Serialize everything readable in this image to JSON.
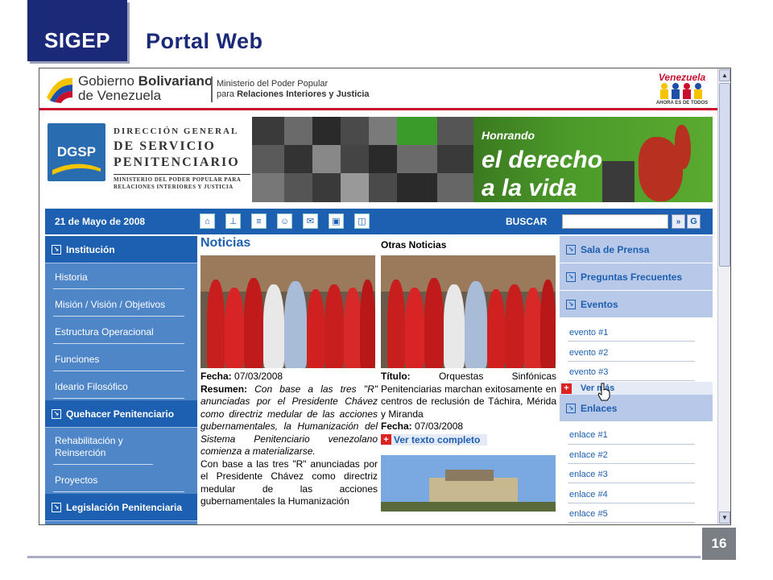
{
  "slide": {
    "brand": "SIGEP",
    "title": "Portal Web",
    "page_number": "16"
  },
  "header": {
    "gov_line1": "Gobierno ",
    "gov_line1_bold": "Bolivariano",
    "gov_line2": "de Venezuela",
    "ministry_line1": "Ministerio del Poder Popular",
    "ministry_line2_prefix": "para ",
    "ministry_line2": "Relaciones Interiores y Justicia",
    "venezuela_logo": "Venezuela",
    "venezuela_slogan": "AHORA ES DE TODOS"
  },
  "dgsp": {
    "acronym": "DGSP",
    "line1": "DIRECCIÓN GENERAL",
    "line2": "DE SERVICIO",
    "line3": "PENITENCIARIO",
    "line4": "MINISTERIO DEL PODER POPULAR PARA RELACIONES INTERIORES Y JUSTICIA"
  },
  "banner": {
    "line1": "Honrando",
    "line2": "el derecho",
    "line3": "a la vida"
  },
  "nav": {
    "date": "21 de Mayo de 2008",
    "search_label": "BUSCAR",
    "search_value": "",
    "icons": [
      "home-icon",
      "sitemap-icon",
      "document-icon",
      "people-icon",
      "mail-icon",
      "folder-icon",
      "gallery-icon"
    ]
  },
  "left_menu": {
    "institucion": "Institución",
    "items": [
      "Historia",
      "Misión / Visión / Objetivos",
      "Estructura Operacional",
      "Funciones",
      "Ideario Filosófico"
    ],
    "quehacer": "Quehacer Penitenciario",
    "quehacer_items": [
      "Rehabilitación y Reinserción",
      "Proyectos"
    ],
    "legislacion": "Legislación Penitenciaria"
  },
  "noticias": {
    "title": "Noticias",
    "fecha_label": "Fecha:",
    "fecha": " 07/03/2008",
    "resumen_label": "Resumen:",
    "resumen": " Con base a las tres \"R\" anunciadas por el Presidente Chávez como directriz medular de las acciones gubernamentales, la Humanización del Sistema Penitenciario venezolano comienza a materializarse.",
    "body": "Con base a las tres \"R\" anunciadas por el Presidente Chávez como directriz medular de las acciones gubernamentales la Humanización"
  },
  "otras": {
    "title": "Otras Noticias",
    "titulo_label": "Título:",
    "titulo": " Orquestas Sinfónicas Penitenciarias marchan exitosamente en centros de reclusión de Táchira, Mérida y Miranda",
    "fecha_label": "Fecha:",
    "fecha": " 07/03/2008",
    "ver_texto": "Ver texto completo"
  },
  "right_menu": {
    "sala_prensa": "Sala de Prensa",
    "preguntas": "Preguntas Frecuentes",
    "eventos": "Eventos",
    "eventos_items": [
      "evento #1",
      "evento #2",
      "evento #3"
    ],
    "ver_mas": "Ver más",
    "enlaces": "Enlaces",
    "enlaces_items": [
      "enlace #1",
      "enlace #2",
      "enlace #3",
      "enlace #4",
      "enlace #5"
    ]
  },
  "colors": {
    "brand_navy": "#1a2a78",
    "portal_blue": "#1d5fb0",
    "sidebar_blue": "#4f86c8",
    "accent_red": "#c8102e"
  }
}
